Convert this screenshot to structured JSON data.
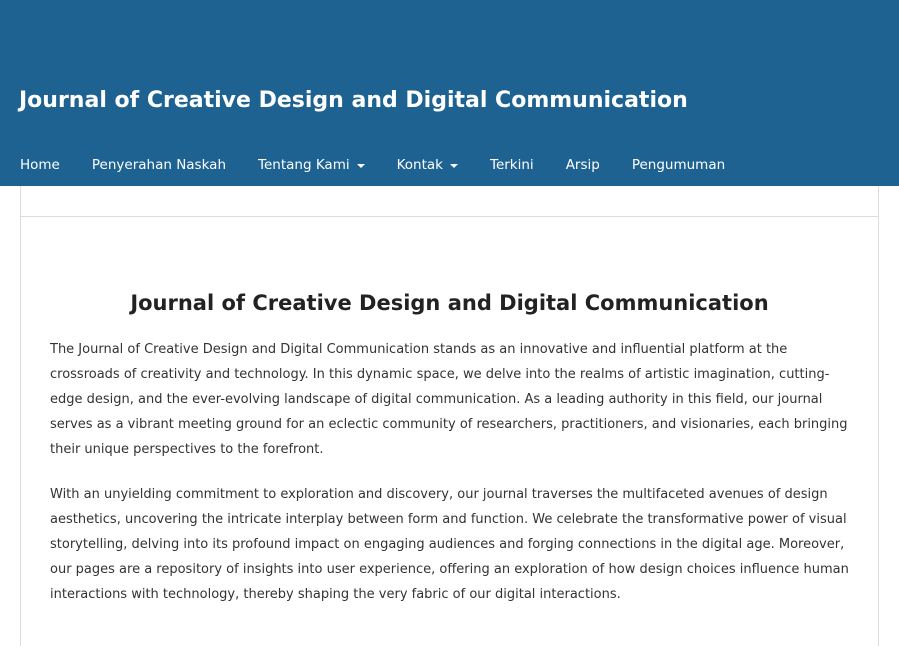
{
  "header": {
    "site_title": "Journal of Creative Design and Digital Communication",
    "background_color": "#1e6292"
  },
  "nav": {
    "items": [
      {
        "label": "Home",
        "has_dropdown": false
      },
      {
        "label": "Penyerahan Naskah",
        "has_dropdown": false
      },
      {
        "label": "Tentang Kami",
        "has_dropdown": true
      },
      {
        "label": "Kontak",
        "has_dropdown": true
      },
      {
        "label": "Terkini",
        "has_dropdown": false
      },
      {
        "label": "Arsip",
        "has_dropdown": false
      },
      {
        "label": "Pengumuman",
        "has_dropdown": false
      }
    ]
  },
  "main": {
    "heading": "Journal of Creative Design and Digital Communication",
    "paragraphs": [
      "The Journal of Creative Design and Digital Communication stands as an innovative and influential platform at the crossroads of creativity and technology. In this dynamic space, we delve into the realms of artistic imagination, cutting-edge design, and the ever-evolving landscape of digital communication. As a leading authority in this field, our journal serves as a vibrant meeting ground for an eclectic community of researchers, practitioners, and visionaries, each bringing their unique perspectives to the forefront.",
      "With an unyielding commitment to exploration and discovery, our journal traverses the multifaceted avenues of design aesthetics, uncovering the intricate interplay between form and function. We celebrate the transformative power of visual storytelling, delving into its profound impact on engaging audiences and forging connections in the digital age. Moreover, our pages are a repository of insights into user experience, offering an exploration of how design choices influence human interactions with technology, thereby shaping the very fabric of our digital interactions."
    ]
  }
}
